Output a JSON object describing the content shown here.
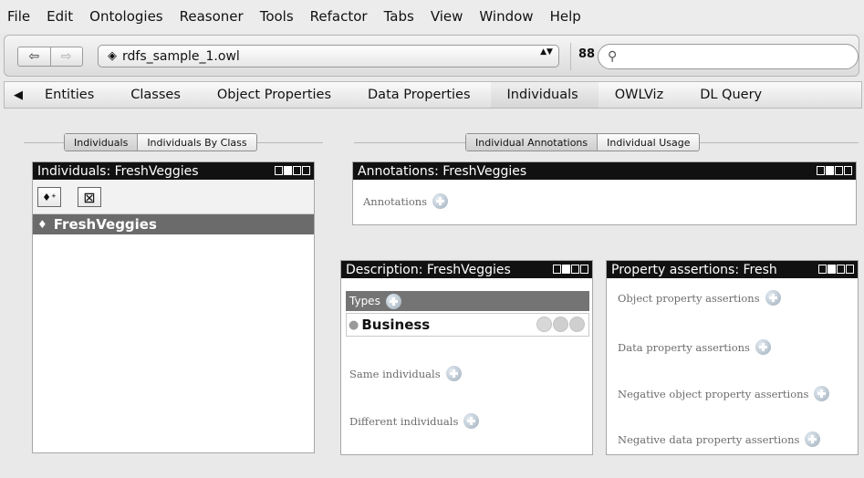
{
  "menu": [
    "File",
    "Edit",
    "Ontologies",
    "Reasoner",
    "Tools",
    "Refactor",
    "Tabs",
    "View",
    "Window",
    "Help"
  ],
  "toolbar": {
    "back_glyph": "⇦",
    "forward_glyph": "⇨",
    "ontology": "rdfs_sample_1.owl",
    "ontology_icon": "◈",
    "stepper": "▲▼",
    "binoculars": "88",
    "search_icon": "⚲",
    "search_placeholder": ""
  },
  "tabs": {
    "scroll_left": "◀",
    "items": [
      "Entities",
      "Classes",
      "Object Properties",
      "Data Properties",
      "Individuals",
      "OWLViz",
      "DL Query"
    ],
    "active": "Individuals"
  },
  "left": {
    "subtabs": [
      "Individuals",
      "Individuals By Class"
    ],
    "title": "Individuals: FreshVeggies",
    "add_icon": "♦⁺",
    "delete_icon": "⊠",
    "selected_icon": "♦",
    "selected_item": "FreshVeggies"
  },
  "right_top": {
    "subtabs": [
      "Individual Annotations",
      "Individual Usage"
    ],
    "title": "Annotations: FreshVeggies",
    "annotations_label": "Annotations"
  },
  "description": {
    "title": "Description: FreshVeggies",
    "types_label": "Types",
    "type_bullet": "●",
    "type_value": "Business",
    "same_label": "Same individuals",
    "different_label": "Different individuals"
  },
  "property": {
    "title": "Property assertions: Fresh",
    "object_label": "Object property assertions",
    "data_label": "Data property assertions",
    "neg_object_label": "Negative object property assertions",
    "neg_data_label": "Negative data property assertions"
  },
  "colors": {
    "titlebar": "#111111",
    "selection": "#6b6b6b",
    "types_header": "#747474"
  }
}
